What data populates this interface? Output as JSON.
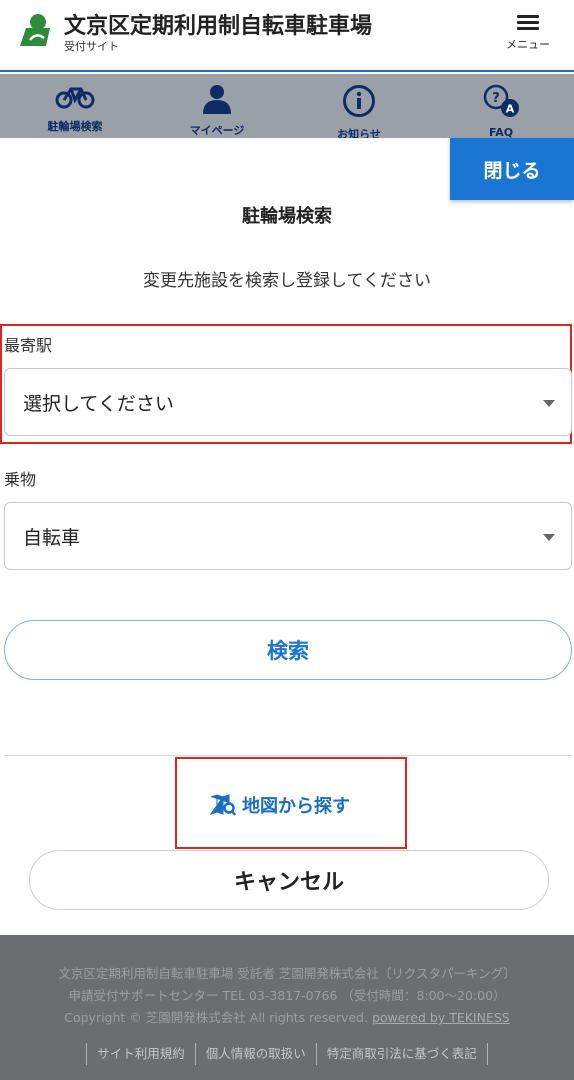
{
  "header": {
    "title": "文京区定期利用制自転車駐車場",
    "subtitle": "受付サイト",
    "menu_label": "メニュー"
  },
  "nav": {
    "items": [
      {
        "label": "駐輪場検索",
        "icon": "bicycle-icon"
      },
      {
        "label": "マイページ",
        "icon": "person-icon"
      },
      {
        "label": "お知らせ",
        "icon": "info-icon"
      },
      {
        "label": "FAQ",
        "icon": "faq-icon"
      }
    ]
  },
  "modal": {
    "close_label": "閉じる",
    "title": "駐輪場検索",
    "description": "変更先施設を検索し登録してください",
    "station": {
      "label": "最寄駅",
      "value": "選択してください"
    },
    "vehicle": {
      "label": "乗物",
      "value": "自転車"
    },
    "search_label": "検索",
    "map_label": "地図から探す",
    "cancel_label": "キャンセル"
  },
  "footer": {
    "line1": "文京区定期利用制自転車駐車場 受託者 芝園開発株式会社〔リクスタパーキング〕",
    "line2": "申請受付サポートセンター TEL 03-3817-0766 （受付時間：8:00～20:00）",
    "copyright": "Copyright © 芝園開発株式会社 All rights reserved.",
    "powered_by": "powered by TEKINESS",
    "links": [
      "サイト利用規約",
      "個人情報の取扱い",
      "特定商取引法に基づく表記"
    ]
  },
  "colors": {
    "accent": "#1a76d2",
    "highlight": "#e02424",
    "overlay_gray": "#9aa0a8"
  }
}
